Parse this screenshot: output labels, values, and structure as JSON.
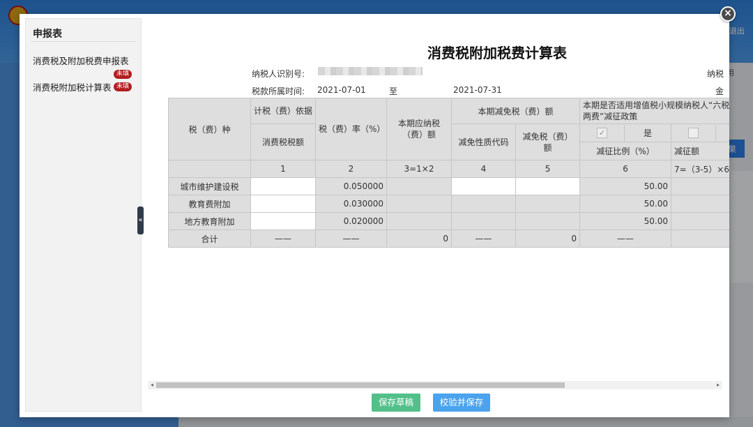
{
  "background": {
    "logout": "退出",
    "side_text": "用",
    "button": "果"
  },
  "modal": {
    "close": "×"
  },
  "sidebar": {
    "title": "申报表",
    "items": [
      {
        "label": "消费税及附加税费申报表",
        "badge": "未填"
      },
      {
        "label": "消费税附加税计算表",
        "badge": "未填"
      }
    ],
    "collapse": "«"
  },
  "document": {
    "title": "消费税附加税费计算表",
    "taxpayer_id_label": "纳税人识别号:",
    "taxpayer_name_label": "纳税",
    "period_label": "税款所属时间:",
    "period_start": "2021-07-01",
    "period_to": "至",
    "period_end": "2021-07-31",
    "amount_unit_label": "金"
  },
  "table": {
    "headers": {
      "tax_type": "税（费）种",
      "basis": "计税（费）依据",
      "basis_sub": "消费税税额",
      "rate": "税（费）率（%）",
      "payable": "本期应纳税（费）额",
      "relief": "本期减免税（费）额",
      "relief_code": "减免性质代码",
      "relief_amount": "减免税（费）额",
      "small_scale": "本期是否适用增值税小规模纳税人“六税两费”减征政策",
      "yes": "是",
      "reduction_ratio": "减征比例（%）",
      "reduction_amount": "减征额"
    },
    "col_numbers": [
      "1",
      "2",
      "3=1×2",
      "4",
      "5",
      "6",
      "7=（3-5）×6"
    ],
    "rows": [
      {
        "name": "城市维护建设税",
        "rate": "0.050000",
        "ratio": "50.00"
      },
      {
        "name": "教育费附加",
        "rate": "0.030000",
        "ratio": "50.00"
      },
      {
        "name": "地方教育附加",
        "rate": "0.020000",
        "ratio": "50.00"
      }
    ],
    "total": {
      "label": "合计",
      "dash": "——",
      "payable": "0",
      "relief_amount": "0"
    }
  },
  "buttons": {
    "save_draft": "保存草稿",
    "validate_save": "校验并保存"
  }
}
